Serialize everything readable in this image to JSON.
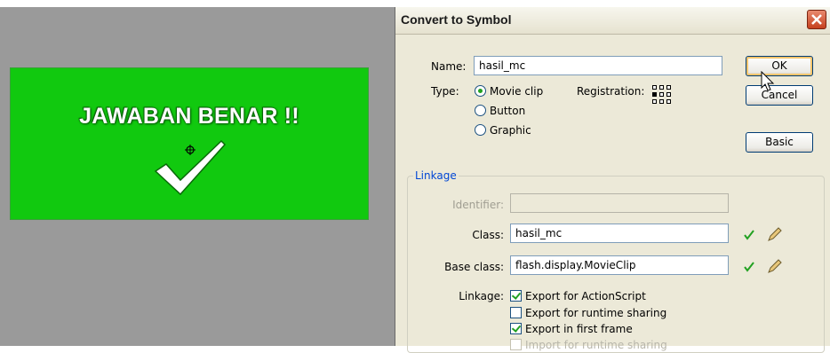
{
  "stage": {
    "symbol_text": "JAWABAN BENAR !!",
    "symbol_color": "#11c90f",
    "icons": {
      "check": "checkmark-icon",
      "registration": "registration-point-icon"
    }
  },
  "dialog": {
    "title": "Convert to Symbol",
    "name": {
      "label": "Name:",
      "value": "hasil_mc"
    },
    "type": {
      "label": "Type:",
      "options": [
        "Movie clip",
        "Button",
        "Graphic"
      ],
      "selected": "Movie clip"
    },
    "registration_label": "Registration:",
    "buttons": {
      "ok": "OK",
      "cancel": "Cancel",
      "basic": "Basic"
    },
    "linkage_group": {
      "legend": "Linkage",
      "identifier_label": "Identifier:",
      "identifier_value": "",
      "class_label": "Class:",
      "class_value": "hasil_mc",
      "base_class_label": "Base class:",
      "base_class_value": "flash.display.MovieClip",
      "linkage_label": "Linkage:",
      "checkboxes": [
        {
          "label": "Export for ActionScript",
          "checked": true,
          "enabled": true
        },
        {
          "label": "Export for runtime sharing",
          "checked": false,
          "enabled": true
        },
        {
          "label": "Export in first frame",
          "checked": true,
          "enabled": true
        },
        {
          "label": "Import for runtime sharing",
          "checked": false,
          "enabled": false
        }
      ]
    },
    "colors": {
      "accent": "#0046d5",
      "check_green": "#21a121",
      "close_red": "#c5401e"
    }
  }
}
